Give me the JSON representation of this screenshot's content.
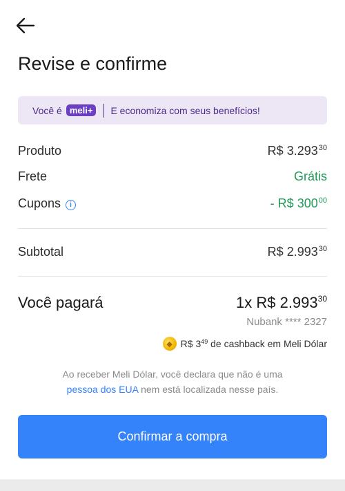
{
  "header": {
    "title": "Revise e confirme"
  },
  "banner": {
    "prefix": "Você é",
    "badge": "meli+",
    "text": "E economiza com seus benefícios!"
  },
  "summary": {
    "produto": {
      "label": "Produto",
      "currency": "R$",
      "integer": "3.293",
      "cents": "30"
    },
    "frete": {
      "label": "Frete",
      "value": "Grátis"
    },
    "cupons": {
      "label": "Cupons",
      "prefix": "- R$",
      "integer": "300",
      "cents": "00"
    },
    "subtotal": {
      "label": "Subtotal",
      "currency": "R$",
      "integer": "2.993",
      "cents": "30"
    }
  },
  "payment": {
    "label": "Você pagará",
    "installments": "1x R$",
    "integer": "2.993",
    "cents": "30",
    "card": "Nubank **** 2327",
    "cashback_currency": "R$",
    "cashback_integer": "3",
    "cashback_cents": "49",
    "cashback_text": "de cashback em Meli Dólar"
  },
  "disclaimer": {
    "text1": "Ao receber Meli Dólar, você declara que não é uma",
    "link": "pessoa dos EUA",
    "text2": "nem está localizada nesse país."
  },
  "button": {
    "confirm_label": "Confirmar a compra"
  },
  "colors": {
    "accent": "#3483fa",
    "green": "#1f9a55",
    "purple": "#6b3fc4"
  }
}
